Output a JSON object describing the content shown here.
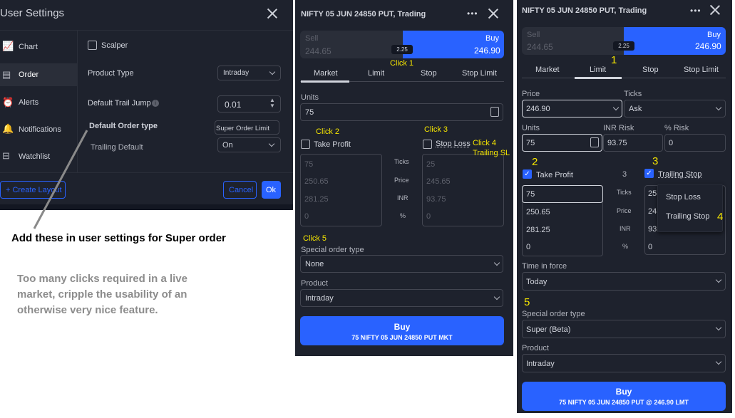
{
  "s": {
    "title": "User Settings",
    "nav": [
      "Chart",
      "Order",
      "Alerts",
      "Notifications",
      "Watchlist"
    ],
    "scalper": "Scalper",
    "pt": "Product Type",
    "pt_v": "Intraday",
    "tj": "Default Trail Jump",
    "tj_v": "0.01",
    "dot": "Default Order type",
    "dot_v": "Super Order Limit",
    "td": "Trailing Default",
    "td_v": "On",
    "create": "+ Create Layout",
    "cancel": "Cancel",
    "ok": "Ok"
  },
  "notes": {
    "add": "Add these in user settings for Super order",
    "p1": "Too many clicks required in a live",
    "p2": "market, cripple the usability of an",
    "p3": "otherwise very nice feature."
  },
  "m": {
    "title": "NIFTY 05 JUN 24850 PUT, Trading",
    "sell": "Sell",
    "sell_v": "244.65",
    "spread": "2.25",
    "buy": "Buy",
    "buy_v": "246.90",
    "tabs": [
      "Market",
      "Limit",
      "Stop",
      "Stop Limit"
    ],
    "units": "Units",
    "units_v": "75",
    "tp": "Take Profit",
    "sl": "Stop Loss",
    "ticks": "Ticks",
    "price": "Price",
    "inr": "INR",
    "pct": "%",
    "l": [
      "75",
      "250.65",
      "281.25",
      "0"
    ],
    "r": [
      "25",
      "245.65",
      "93.75",
      "0"
    ],
    "sot": "Special order type",
    "sot_v": "None",
    "prod": "Product",
    "prod_v": "Intraday",
    "btn": "Buy",
    "btn_sub": "75 NIFTY 05 JUN 24850 PUT MKT"
  },
  "clicks": {
    "c1": "Click 1",
    "c2": "Click 2",
    "c3": "Click 3",
    "c4a": "Click 4",
    "c4b": "Trailing SL",
    "c5": "Click 5"
  },
  "n": {
    "title": "NIFTY 05 JUN 24850 PUT, Trading",
    "sell": "Sell",
    "sell_v": "244.65",
    "spread": "2.25",
    "buy": "Buy",
    "buy_v": "246.90",
    "tabs": [
      "Market",
      "Limit",
      "Stop",
      "Stop Limit"
    ],
    "price": "Price",
    "price_v": "246.90",
    "ticks": "Ticks",
    "ticks_v": "Ask",
    "units": "Units",
    "units_v": "75",
    "risk": "INR Risk",
    "risk_v": "93.75",
    "prisk": "% Risk",
    "prisk_v": "0",
    "tp": "Take Profit",
    "three": "3",
    "ts": "Trailing Stop",
    "tk": "Ticks",
    "pr": "Price",
    "inr": "INR",
    "pct": "%",
    "l": [
      "75",
      "250.65",
      "281.25",
      "0"
    ],
    "r": [
      "25",
      "245",
      "93.",
      "0"
    ],
    "menu": [
      "Stop Loss",
      "Trailing Stop"
    ],
    "tif": "Time in force",
    "tif_v": "Today",
    "sot": "Special order type",
    "sot_v": "Super (Beta)",
    "prod": "Product",
    "prod_v": "Intraday",
    "btn": "Buy",
    "btn_sub": "75 NIFTY 05 JUN 24850 PUT @ 246.90 LMT",
    "n": [
      "1",
      "2",
      "3",
      "4",
      "5"
    ]
  }
}
